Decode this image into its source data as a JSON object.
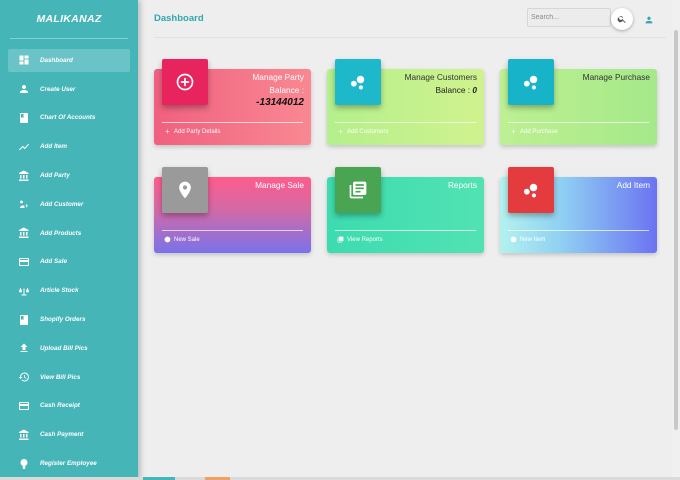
{
  "brand": "MALIKANAZ",
  "page_title": "Dashboard",
  "search": {
    "placeholder": "Search..."
  },
  "sidebar": {
    "items": [
      {
        "label": "Dashboard",
        "icon": "dashboard-icon",
        "active": true
      },
      {
        "label": "Create User",
        "icon": "user-icon"
      },
      {
        "label": "Chart Of Accounts",
        "icon": "book-icon"
      },
      {
        "label": "Add Item",
        "icon": "trending-icon"
      },
      {
        "label": "Add Party",
        "icon": "bank-icon"
      },
      {
        "label": "Add Customer",
        "icon": "customer-icon"
      },
      {
        "label": "Add Products",
        "icon": "bank-icon"
      },
      {
        "label": "Add Sale",
        "icon": "card-icon"
      },
      {
        "label": "Article Stock",
        "icon": "scale-icon"
      },
      {
        "label": "Shopify Orders",
        "icon": "book-icon"
      },
      {
        "label": "Upload Bill Pics",
        "icon": "upload-icon"
      },
      {
        "label": "View Bill Pics",
        "icon": "history-icon"
      },
      {
        "label": "Cash Receipt",
        "icon": "card-icon"
      },
      {
        "label": "Cash Payment",
        "icon": "bank-icon"
      },
      {
        "label": "Register Employee",
        "icon": "pin-icon"
      }
    ]
  },
  "cards": {
    "party": {
      "title": "Manage Party",
      "balance_label": "Balance :",
      "balance_value": "-13144012",
      "footer": "Add Party Details"
    },
    "customers": {
      "title": "Manage Customers",
      "balance_label": "Balance :",
      "balance_value": "0",
      "footer": "Add Customers"
    },
    "purchase": {
      "title": "Manage Purchase",
      "footer": "Add Purchase"
    },
    "sale": {
      "title": "Manage Sale",
      "footer": "New Sale"
    },
    "reports": {
      "title": "Reports",
      "footer": "View Reports"
    },
    "item": {
      "title": "Add Item",
      "footer": "New Item"
    }
  },
  "colors": {
    "sidebar": "#45b5b8",
    "accent": "#2fa8b0",
    "party_icon": "#e8245e",
    "customers_icon": "#1db9cb",
    "sale_icon": "#9a9a9a",
    "reports_icon": "#4aa552",
    "item_icon": "#e33b3e"
  }
}
